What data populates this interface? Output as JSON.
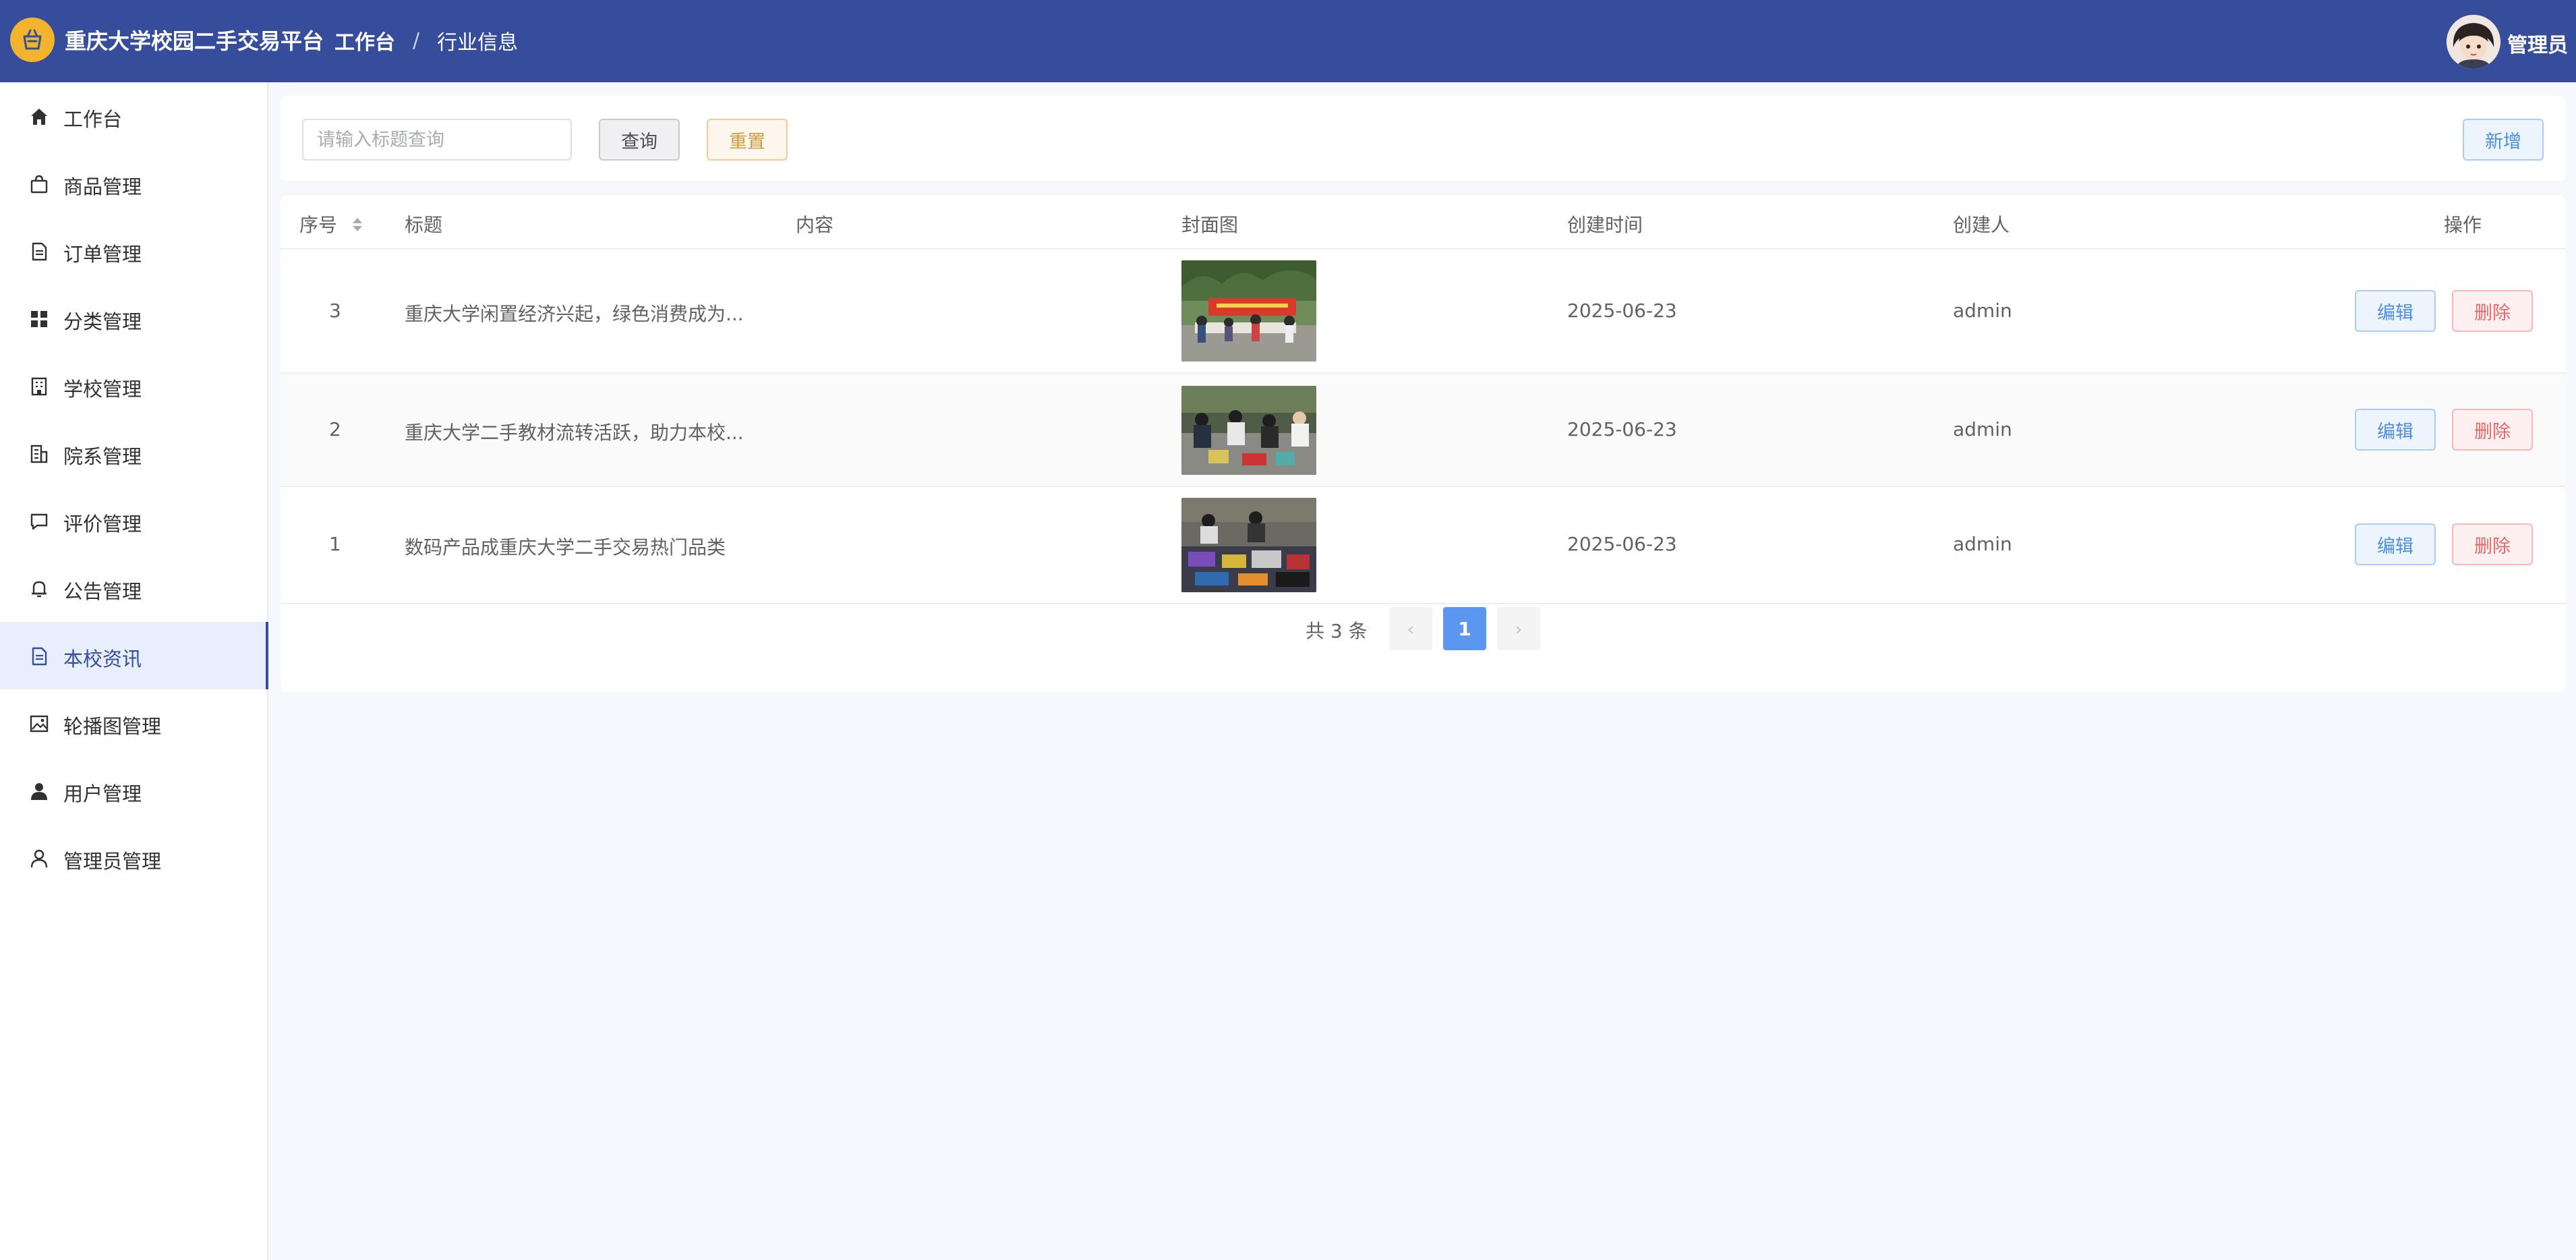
{
  "header": {
    "app_title": "重庆大学校园二手交易平台",
    "breadcrumb_home": "工作台",
    "breadcrumb_sep": "/",
    "breadcrumb_current": "行业信息",
    "admin_name": "管理员"
  },
  "sidebar": {
    "items": [
      {
        "label": "工作台",
        "icon": "home-icon"
      },
      {
        "label": "商品管理",
        "icon": "shopping-bag-icon"
      },
      {
        "label": "订单管理",
        "icon": "document-icon"
      },
      {
        "label": "分类管理",
        "icon": "grid-icon"
      },
      {
        "label": "学校管理",
        "icon": "building-icon"
      },
      {
        "label": "院系管理",
        "icon": "office-building-icon"
      },
      {
        "label": "评价管理",
        "icon": "chat-bubble-icon"
      },
      {
        "label": "公告管理",
        "icon": "bell-icon"
      },
      {
        "label": "本校资讯",
        "icon": "document-icon"
      },
      {
        "label": "轮播图管理",
        "icon": "image-icon"
      },
      {
        "label": "用户管理",
        "icon": "user-filled-icon"
      },
      {
        "label": "管理员管理",
        "icon": "user-outline-icon"
      }
    ],
    "active_index": 8
  },
  "search": {
    "placeholder": "请输入标题查询",
    "value": "",
    "query_label": "查询",
    "reset_label": "重置",
    "add_label": "新增"
  },
  "table": {
    "columns": [
      "序号",
      "标题",
      "内容",
      "封面图",
      "创建时间",
      "创建人",
      "操作"
    ],
    "rows": [
      {
        "index": "3",
        "title": "重庆大学闲置经济兴起，绿色消费成为...",
        "content": "",
        "created": "2025-06-23",
        "creator": "admin",
        "edit": "编辑",
        "delete": "删除"
      },
      {
        "index": "2",
        "title": "重庆大学二手教材流转活跃，助力本校...",
        "content": "",
        "created": "2025-06-23",
        "creator": "admin",
        "edit": "编辑",
        "delete": "删除"
      },
      {
        "index": "1",
        "title": "数码产品成重庆大学二手交易热门品类",
        "content": "",
        "created": "2025-06-23",
        "creator": "admin",
        "edit": "编辑",
        "delete": "删除"
      }
    ]
  },
  "pagination": {
    "total_text": "共 3 条",
    "current_page": "1",
    "prev": "‹",
    "next": "›"
  },
  "colors": {
    "header_bg": "#354d9a",
    "primary": "#5b97f0",
    "warning": "#d39a3f",
    "danger": "#e46a6a"
  }
}
